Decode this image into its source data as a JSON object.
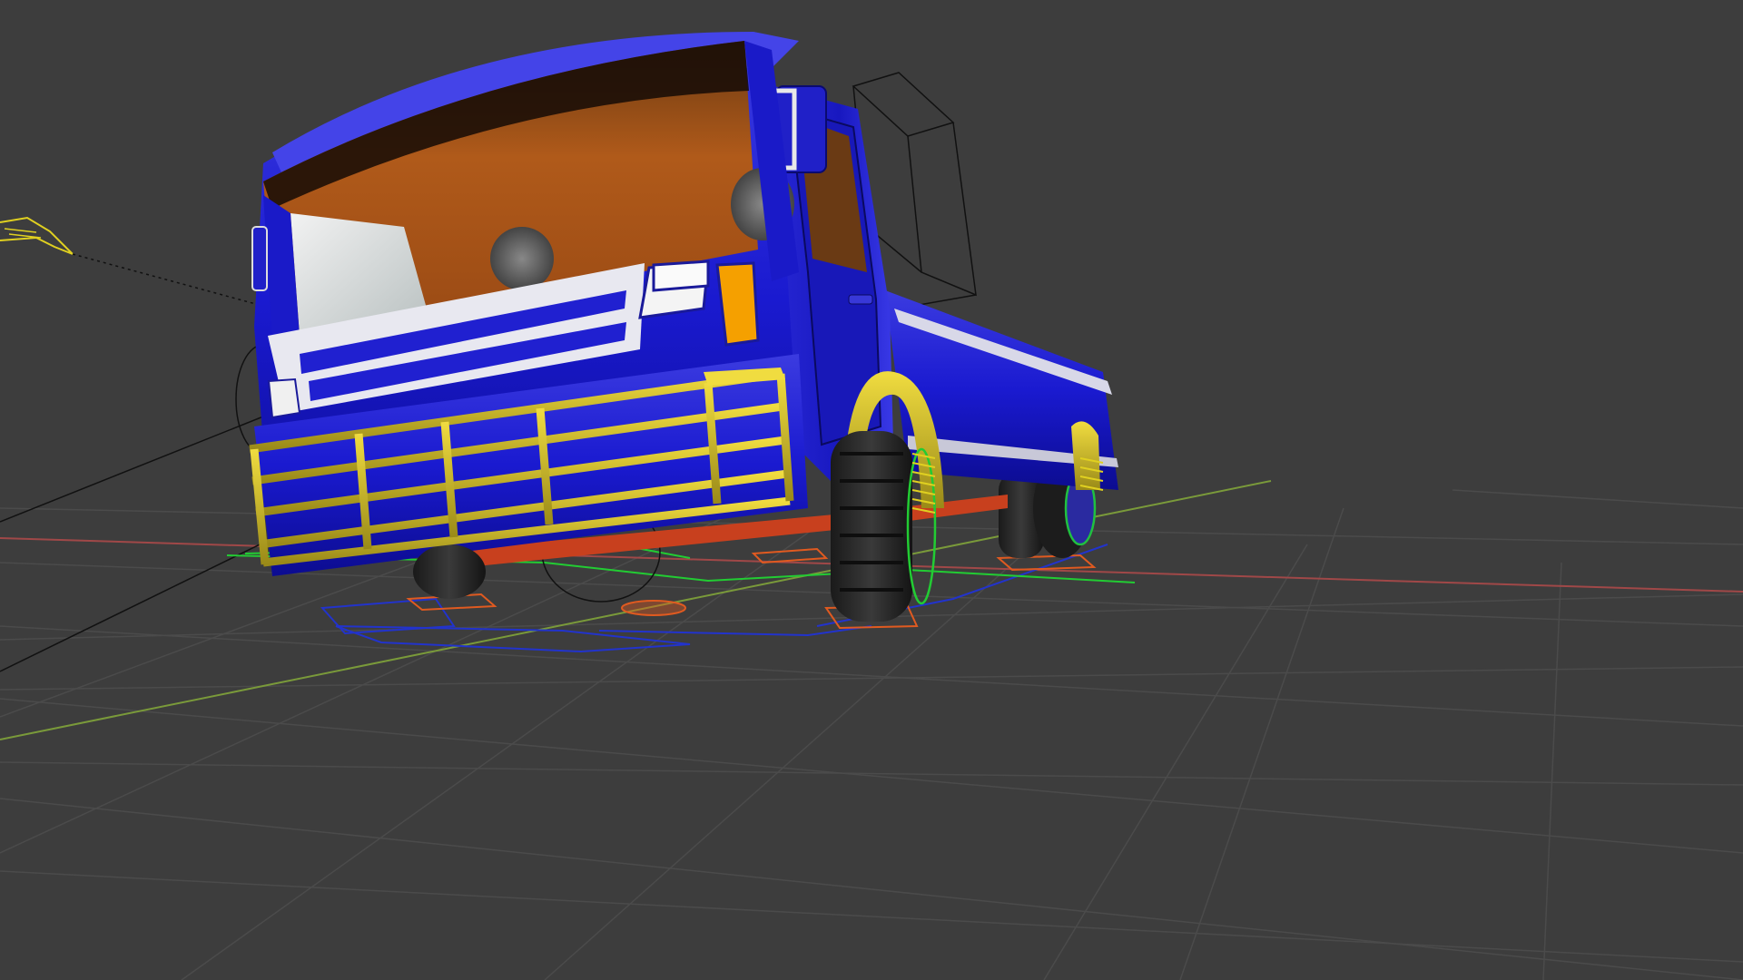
{
  "app": {
    "view": "3d-viewport",
    "shading": "material-preview"
  },
  "scene": {
    "background_color": "#3d3d3d",
    "grid_color": "#4a4a4a",
    "x_axis_color": "#b05050",
    "y_axis_color": "#7a9a3a",
    "object": "pickup-truck",
    "body_color": "#1a1acc",
    "trim_color": "#d4c12a",
    "chassis_color": "#c8401e",
    "interior_color": "#b05a1a",
    "rig_controls": [
      "wheel-controls",
      "steering-control",
      "root-control",
      "suspension-springs"
    ]
  }
}
